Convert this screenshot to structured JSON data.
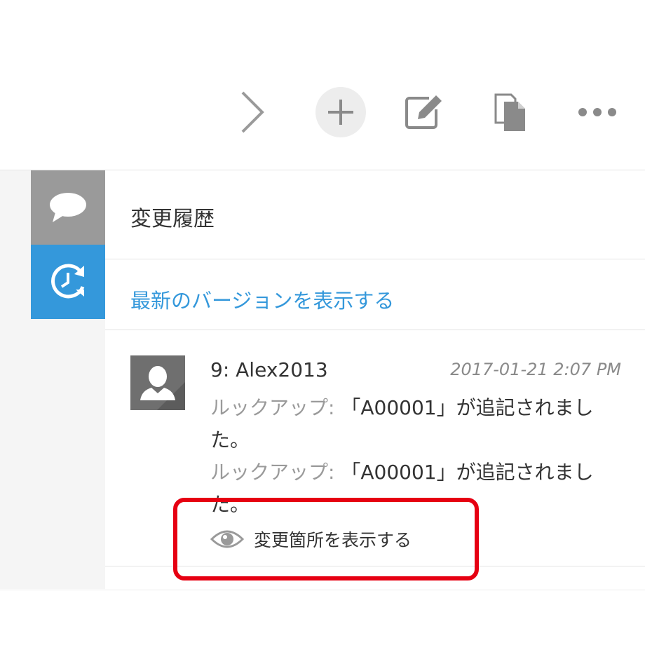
{
  "toolbar": {
    "icons": [
      "chevron-right-icon",
      "plus-icon",
      "edit-icon",
      "duplicate-icon",
      "more-icon"
    ]
  },
  "sidebar": {
    "items": [
      {
        "icon": "comment-icon",
        "active": false
      },
      {
        "icon": "history-icon",
        "active": true
      }
    ]
  },
  "panel": {
    "title": "変更履歴",
    "latest_link": "最新のバージョンを表示する"
  },
  "history": [
    {
      "header": "9: Alex2013",
      "timestamp": "2017-01-21 2:07 PM",
      "changes": [
        {
          "field": "ルックアップ:",
          "text": "「A00001」が追記されました。"
        },
        {
          "field": "ルックアップ:",
          "text": "「A00001」が追記されました。"
        }
      ],
      "show_changes_label": "変更箇所を表示する"
    }
  ],
  "colors": {
    "accent": "#3498db",
    "highlight": "#e60012",
    "sidebar_inactive": "#9a9a9a"
  }
}
